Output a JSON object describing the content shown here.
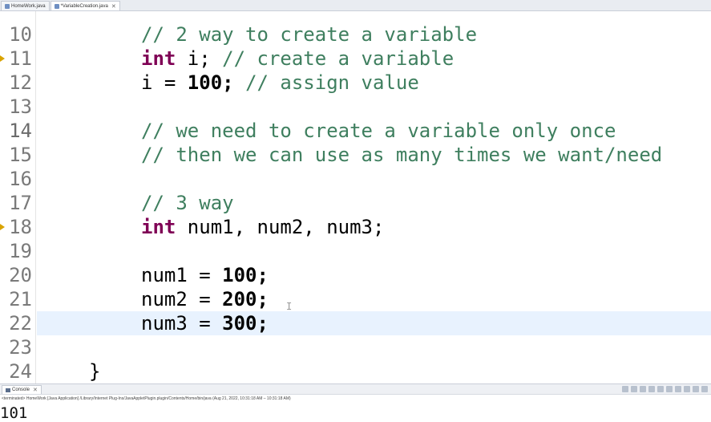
{
  "tabs": [
    {
      "label": "HomeWork.java",
      "active": false
    },
    {
      "label": "*VariableCreation.java",
      "active": true
    }
  ],
  "editor": {
    "lines": [
      {
        "n": "10",
        "indent": 3,
        "parts": [
          {
            "t": "// 2 way to create a variable",
            "c": "cmt"
          }
        ]
      },
      {
        "n": "11",
        "indent": 3,
        "marker": true,
        "parts": [
          {
            "t": "int",
            "c": "kw"
          },
          {
            "t": " i; ",
            "c": ""
          },
          {
            "t": "// create a variable",
            "c": "cmt"
          }
        ]
      },
      {
        "n": "12",
        "indent": 3,
        "parts": [
          {
            "t": "i = ",
            "c": ""
          },
          {
            "t": "100",
            "c": "num"
          },
          {
            "t": "; ",
            "c": "bold"
          },
          {
            "t": "// assign value",
            "c": "cmt"
          }
        ]
      },
      {
        "n": "13",
        "indent": 0,
        "parts": []
      },
      {
        "n": "14",
        "indent": 3,
        "hl": true,
        "parts": [
          {
            "t": "// we need to create a variable only once",
            "c": "cmt"
          }
        ]
      },
      {
        "n": "15",
        "indent": 3,
        "parts": [
          {
            "t": "// then we can use as many times we want/need",
            "c": "cmt"
          }
        ]
      },
      {
        "n": "16",
        "indent": 0,
        "parts": []
      },
      {
        "n": "17",
        "indent": 3,
        "parts": [
          {
            "t": "// 3 way",
            "c": "cmt"
          }
        ]
      },
      {
        "n": "18",
        "indent": 3,
        "marker": true,
        "parts": [
          {
            "t": "int",
            "c": "kw"
          },
          {
            "t": " num1, num2, num3;",
            "c": ""
          }
        ]
      },
      {
        "n": "19",
        "indent": 0,
        "parts": []
      },
      {
        "n": "20",
        "indent": 3,
        "parts": [
          {
            "t": "num1 = ",
            "c": ""
          },
          {
            "t": "100",
            "c": "num"
          },
          {
            "t": ";",
            "c": "bold"
          }
        ]
      },
      {
        "n": "21",
        "indent": 3,
        "parts": [
          {
            "t": "num2 = ",
            "c": ""
          },
          {
            "t": "200",
            "c": "num"
          },
          {
            "t": ";",
            "c": "bold"
          }
        ]
      },
      {
        "n": "22",
        "indent": 3,
        "current": true,
        "parts": [
          {
            "t": "num3 = ",
            "c": ""
          },
          {
            "t": "300",
            "c": "num"
          },
          {
            "t": ";",
            "c": "bold"
          }
        ]
      },
      {
        "n": "23",
        "indent": 0,
        "parts": []
      },
      {
        "n": "24",
        "indent": 2,
        "parts": [
          {
            "t": "}",
            "c": ""
          }
        ]
      }
    ]
  },
  "console": {
    "tab_label": "Console",
    "status": "<terminated> HomeWork [Java Application] /Library/Internet Plug-Ins/JavaAppletPlugin.plugin/Contents/Home/bin/java (Aug 21, 2022, 10:31:18 AM – 10:31:18 AM)",
    "output": "101"
  }
}
